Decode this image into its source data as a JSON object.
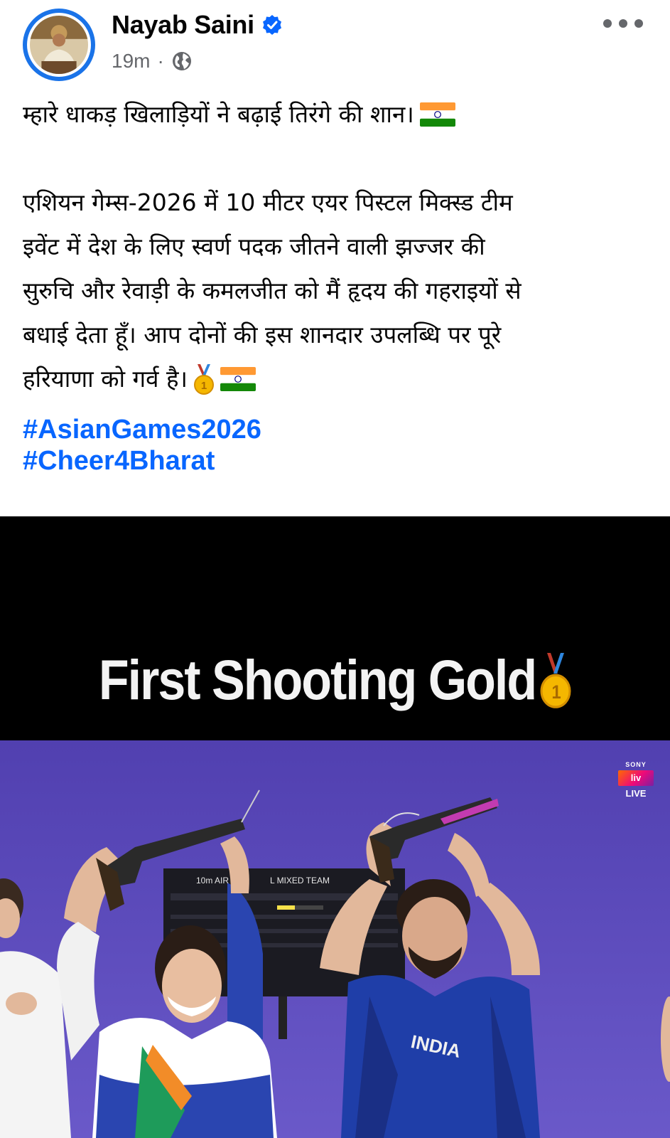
{
  "author": {
    "name": "Nayab Saini",
    "verified": true,
    "time": "19m",
    "separator": "·",
    "audience_icon": "globe-icon"
  },
  "post": {
    "line1": "म्हारे धाकड़ खिलाड़ियों ने बढ़ाई तिरंगे की शान।",
    "para2": [
      "एशियन गेम्स-2026 में 10 मीटर एयर पिस्टल मिक्स्ड टीम",
      "इवेंट में देश के लिए स्वर्ण पदक जीतने वाली झज्जर की",
      "सुरुचि और रेवाड़ी के कमलजीत को मैं हृदय की गहराइयों से",
      "बधाई देता हूँ। आप दोनों की इस शानदार उपलब्धि पर पूरे",
      "हरियाणा को गर्व है।"
    ],
    "hashtags": [
      "#AsianGames2026",
      "#Cheer4Bharat"
    ]
  },
  "media": {
    "title": "First Shooting Gold",
    "broadcaster_top": "SONY",
    "broadcaster_logo": "liv",
    "broadcaster_status": "LIVE",
    "board_event": "10m AIR",
    "board_event2": "L MIXED TEAM",
    "jersey_text": "INDIA"
  },
  "colors": {
    "link": "#0866ff",
    "meta": "#65676b",
    "scene_bg": "#5b49b8"
  }
}
